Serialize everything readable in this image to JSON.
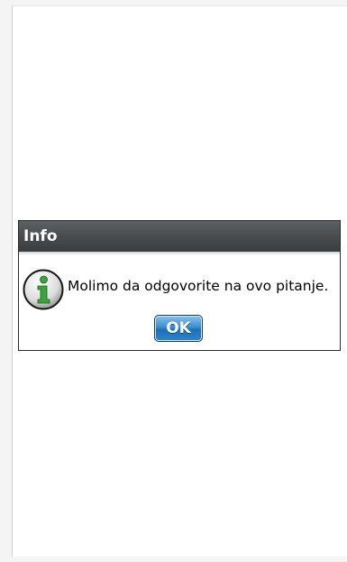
{
  "dialog": {
    "title": "Info",
    "message": "Molimo da odgovorite na ovo pitanje.",
    "icon": "info-icon",
    "ok_label": "OK"
  },
  "colors": {
    "title_bar": "#474b4d",
    "button_blue": "#2a86cf",
    "icon_green": "#3aa53a"
  }
}
